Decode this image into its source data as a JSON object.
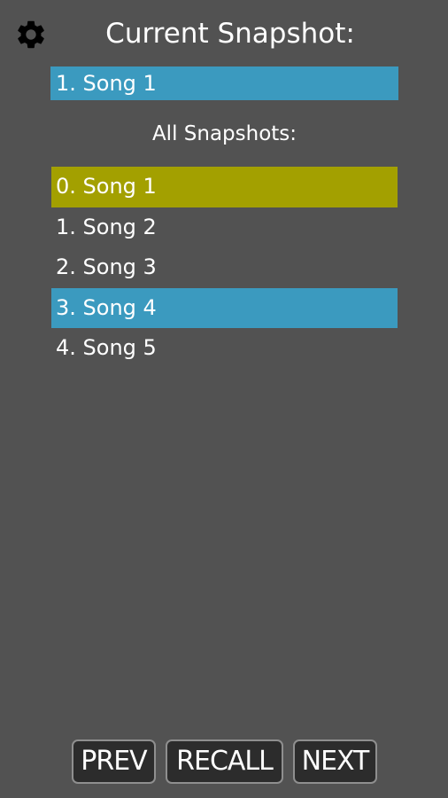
{
  "header": {
    "settings_icon": "gear-icon",
    "title": "Current Snapshot:"
  },
  "current_snapshot": {
    "label": "1. Song 1",
    "color": "#3b9abf"
  },
  "all_snapshots": {
    "heading": "All Snapshots:",
    "items": [
      {
        "label": "0. Song 1",
        "state": "active"
      },
      {
        "label": "1. Song 2",
        "state": "normal"
      },
      {
        "label": "2. Song 3",
        "state": "normal"
      },
      {
        "label": "3. Song 4",
        "state": "selected"
      },
      {
        "label": "4. Song 5",
        "state": "normal"
      }
    ],
    "active_color": "#a3a000",
    "selected_color": "#3b9abf"
  },
  "controls": {
    "prev_label": "PREV",
    "recall_label": "RECALL",
    "next_label": "NEXT"
  },
  "colors": {
    "background": "#525252",
    "button_background": "#2c2c2c",
    "button_border": "#8f8f8f"
  }
}
